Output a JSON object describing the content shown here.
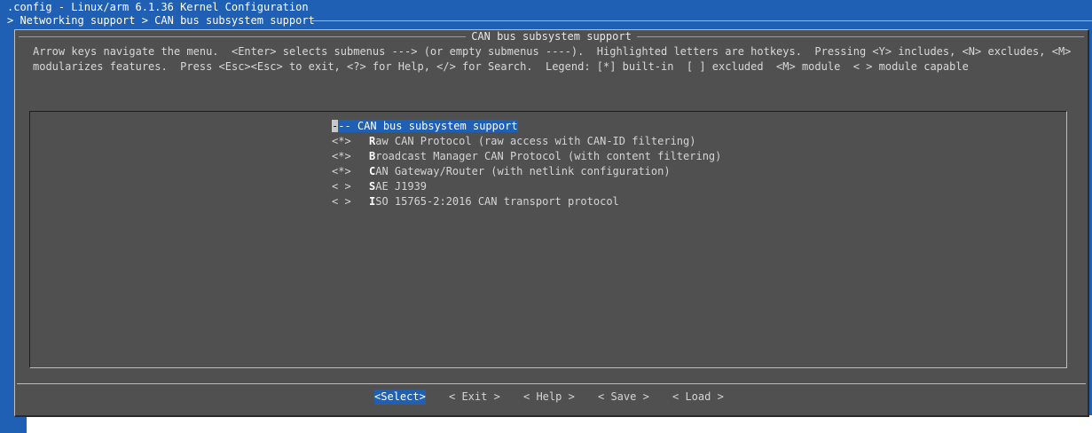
{
  "header": {
    "title": ".config - Linux/arm 6.1.36 Kernel Configuration",
    "breadcrumb": "> Networking support > CAN bus subsystem support"
  },
  "dialog": {
    "title": "CAN bus subsystem support",
    "help_line_1": "Arrow keys navigate the menu.  <Enter> selects submenus ---> (or empty submenus ----).  Highlighted letters are hotkeys.  Pressing <Y> includes, <N> excludes, <M>",
    "help_line_2": "modularizes features.  Press <Esc><Esc> to exit, <?> for Help, </> for Search.  Legend: [*] built-in  [ ] excluded  <M> module  < > module capable"
  },
  "menu": {
    "items": [
      {
        "prefix": "--- ",
        "hotkey": "",
        "label": "CAN bus subsystem support",
        "selected": true
      },
      {
        "prefix": "<*>",
        "hotkey": "R",
        "label": "aw CAN Protocol (raw access with CAN-ID filtering)"
      },
      {
        "prefix": "<*>",
        "hotkey": "B",
        "label": "roadcast Manager CAN Protocol (with content filtering)"
      },
      {
        "prefix": "<*>",
        "hotkey": "C",
        "label": "AN Gateway/Router (with netlink configuration)"
      },
      {
        "prefix": "< >",
        "hotkey": "S",
        "label": "AE J1939"
      },
      {
        "prefix": "< >",
        "hotkey": "I",
        "label": "SO 15765-2:2016 CAN transport protocol"
      }
    ]
  },
  "buttons": {
    "select": "<Select>",
    "exit": "< Exit >",
    "help": "< Help >",
    "save": "< Save >",
    "load": "< Load >"
  },
  "colors": {
    "background_blue": "#1f5fb4",
    "dialog_gray": "#505050",
    "highlight": "#1f5fb4"
  }
}
